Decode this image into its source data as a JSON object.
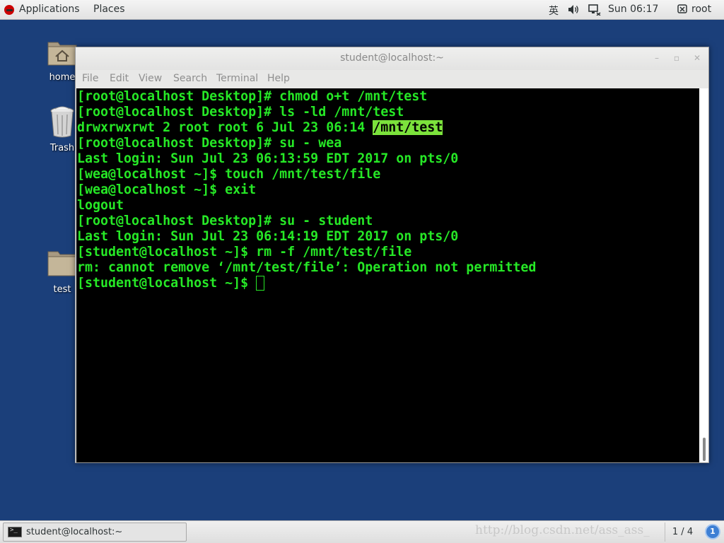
{
  "top_panel": {
    "applications_label": "Applications",
    "places_label": "Places",
    "input_method": "英",
    "clock": "Sun 06:17",
    "user": "root"
  },
  "desktop": {
    "icons": [
      {
        "label": "home",
        "icon": "home-folder-icon"
      },
      {
        "label": "Trash",
        "icon": "trash-icon"
      },
      {
        "label": "test",
        "icon": "folder-icon"
      }
    ]
  },
  "window": {
    "title": "student@localhost:~",
    "menu": [
      "File",
      "Edit",
      "View",
      "Search",
      "Terminal",
      "Help"
    ]
  },
  "terminal": {
    "lines": [
      "[root@localhost Desktop]# chmod o+t /mnt/test",
      "[root@localhost Desktop]# ls -ld /mnt/test",
      "drwxrwxrwt 2 root root 6 Jul 23 06:14 ",
      "[root@localhost Desktop]# su - wea",
      "Last login: Sun Jul 23 06:13:59 EDT 2017 on pts/0",
      "[wea@localhost ~]$ touch /mnt/test/file",
      "[wea@localhost ~]$ exit",
      "logout",
      "[root@localhost Desktop]# su - student",
      "Last login: Sun Jul 23 06:14:19 EDT 2017 on pts/0",
      "[student@localhost ~]$ rm -f /mnt/test/file",
      "rm: cannot remove ‘/mnt/test/file’: Operation not permitted",
      "[student@localhost ~]$ "
    ],
    "highlighted_dir": "/mnt/test",
    "text_color": "#26e826",
    "background": "#000000"
  },
  "bottom_panel": {
    "task_label": "student@localhost:~",
    "watermark": "http://blog.csdn.net/ass_ass_",
    "workspace": "1 / 4",
    "notifications": "1"
  }
}
